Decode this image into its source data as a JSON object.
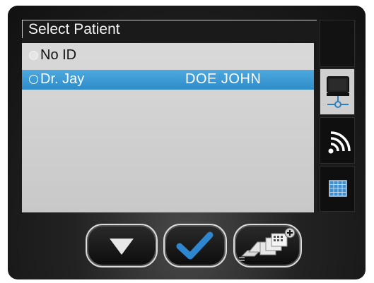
{
  "header": {
    "title": "Select Patient"
  },
  "patients": [
    {
      "id": "No ID",
      "name": "",
      "selected": false
    },
    {
      "id": "Dr. Jay",
      "name": "DOE JOHN",
      "selected": true
    }
  ],
  "side_tabs": [
    {
      "icon": "blank"
    },
    {
      "icon": "display-network-icon",
      "active": true
    },
    {
      "icon": "wireless-icon"
    },
    {
      "icon": "grid-icon"
    }
  ],
  "buttons": [
    {
      "icon": "down-arrow-icon"
    },
    {
      "icon": "checkmark-icon"
    },
    {
      "icon": "add-multiple-images-icon"
    }
  ],
  "colors": {
    "selection": "#2d8bc9",
    "list_bg": "#d0d0d0",
    "accent_blue": "#2e7fbf"
  }
}
